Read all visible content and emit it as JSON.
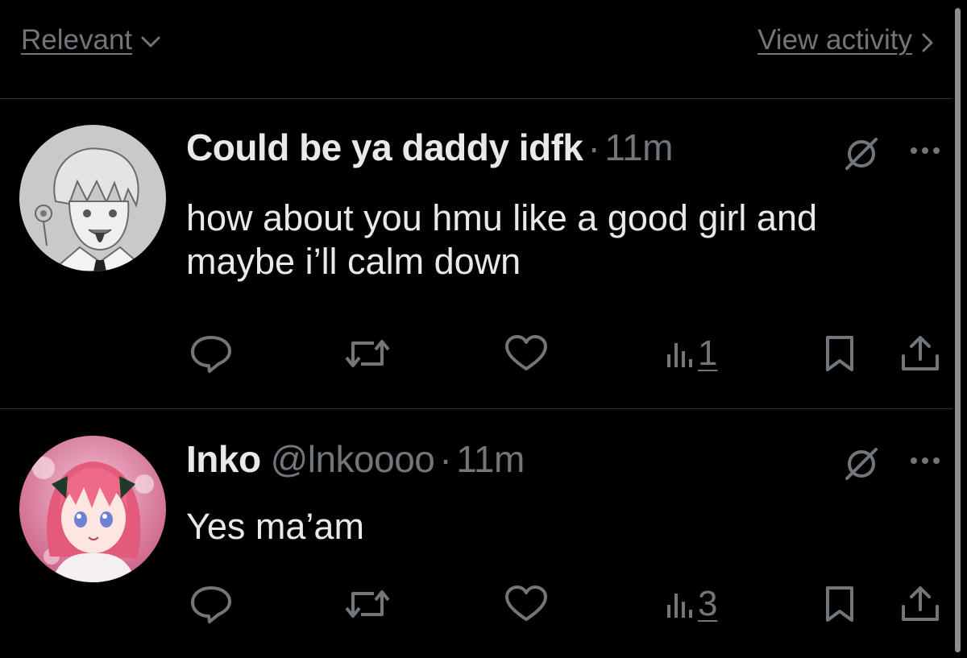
{
  "header": {
    "sort_label": "Relevant",
    "activity_label": "View activity"
  },
  "tweets": [
    {
      "display_name": "Could be ya daddy idfk",
      "handle": "",
      "separator": "·",
      "time": "11m",
      "text": "how about you hmu like a good girl and maybe i’ll calm down",
      "views": "1"
    },
    {
      "display_name": "Inko",
      "handle": "@lnkoooo",
      "separator": "·",
      "time": "11m",
      "text": "Yes ma’am",
      "views": "3"
    }
  ],
  "icons": {
    "sort": "chevron-down-icon",
    "activity": "chevron-right-icon",
    "mute": "mute-icon",
    "more": "more-icon",
    "reply": "reply-icon",
    "retweet": "retweet-icon",
    "like": "heart-icon",
    "views": "views-icon",
    "bookmark": "bookmark-icon",
    "share": "share-icon"
  },
  "colors": {
    "background": "#000000",
    "primary_text": "#e7e9ea",
    "secondary_text": "#71767b",
    "divider": "#2f3336"
  }
}
